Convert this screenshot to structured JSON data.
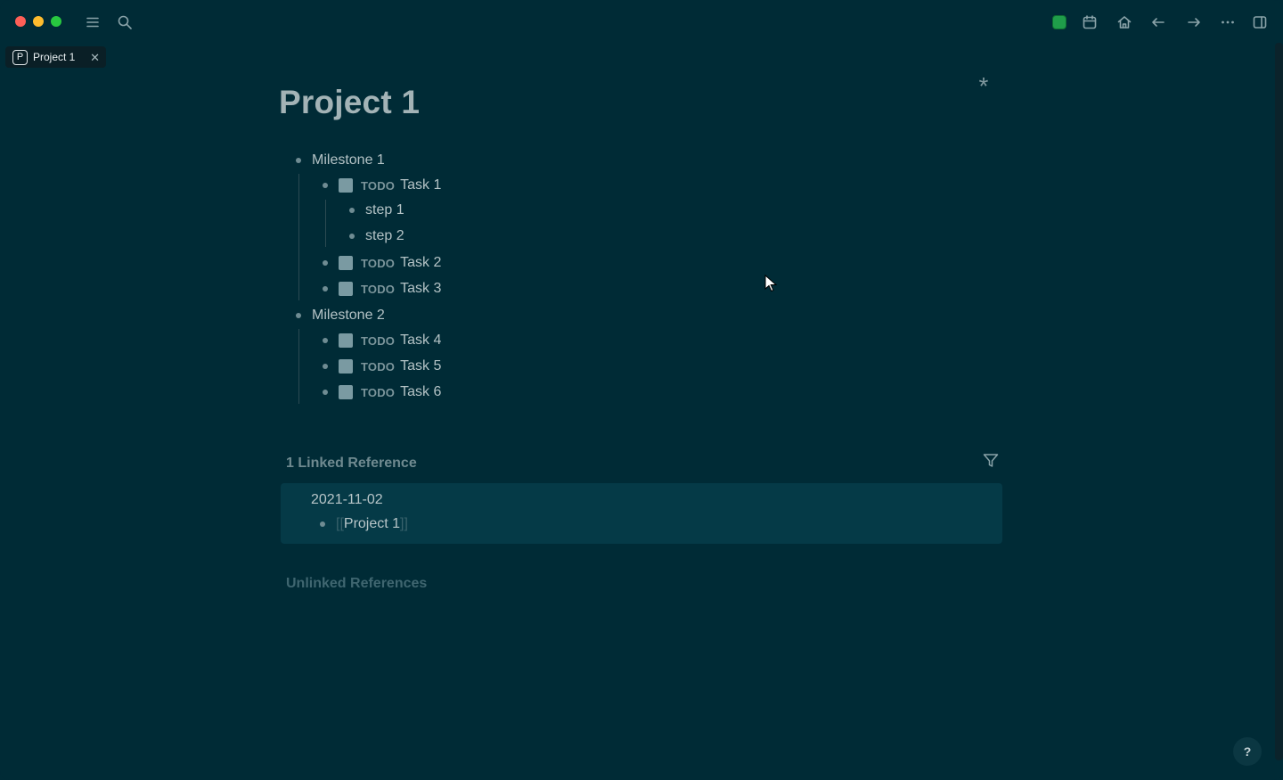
{
  "tab": {
    "badge": "P",
    "label": "Project 1",
    "close": "✕"
  },
  "page": {
    "title": "Project 1"
  },
  "outline": [
    {
      "text": "Milestone 1"
    },
    {
      "todo": "TODO",
      "text": "Task 1"
    },
    {
      "text": "step 1"
    },
    {
      "text": "step 2"
    },
    {
      "todo": "TODO",
      "text": "Task 2"
    },
    {
      "todo": "TODO",
      "text": "Task 3"
    },
    {
      "text": "Milestone 2"
    },
    {
      "todo": "TODO",
      "text": "Task 4"
    },
    {
      "todo": "TODO",
      "text": "Task 5"
    },
    {
      "todo": "TODO",
      "text": "Task 6"
    }
  ],
  "linked_refs": {
    "title": "1 Linked Reference",
    "card": {
      "date": "2021-11-02",
      "open_bracket": "[[",
      "link": "Project 1",
      "close_bracket": "]]"
    }
  },
  "unlinked_refs": {
    "title": "Unlinked References"
  },
  "help": {
    "label": "?"
  },
  "colors": {
    "background": "#002b36",
    "card": "#053a47",
    "sync": "#1f9d4a"
  }
}
